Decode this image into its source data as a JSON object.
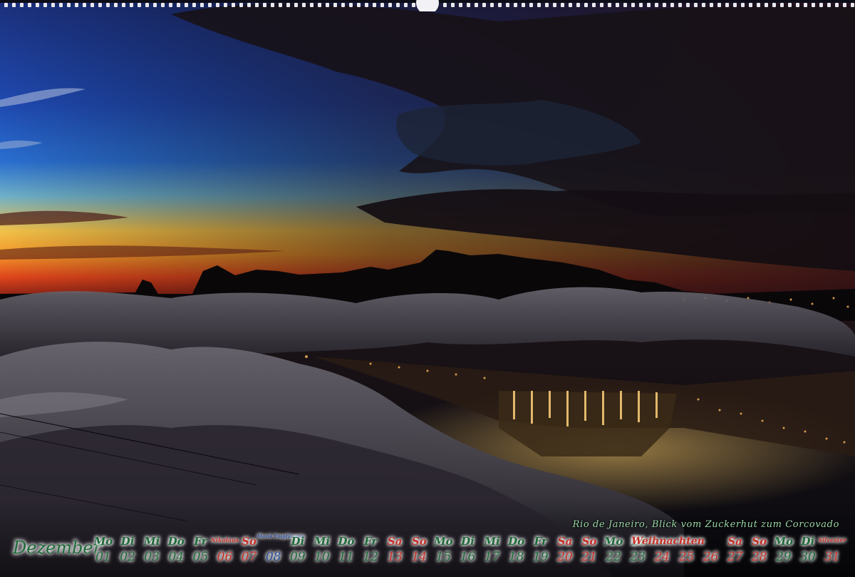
{
  "calendar": {
    "month": "Dezember",
    "caption": "Rio de Janeiro, Blick vom Zuckerhut zum Corcovado",
    "days": [
      {
        "name": "Mo",
        "num": "01",
        "kind": "workday"
      },
      {
        "name": "Di",
        "num": "02",
        "kind": "workday"
      },
      {
        "name": "Mi",
        "num": "03",
        "kind": "workday"
      },
      {
        "name": "Do",
        "num": "04",
        "kind": "workday"
      },
      {
        "name": "Fr",
        "num": "05",
        "kind": "workday"
      },
      {
        "name": "Nikolaus",
        "num": "06",
        "kind": "weekend",
        "style": "small"
      },
      {
        "name": "So",
        "num": "07",
        "kind": "weekend"
      },
      {
        "name": "Mariä Empfängnis",
        "num": "08",
        "kind": "feast",
        "style": "tiny"
      },
      {
        "name": "Di",
        "num": "09",
        "kind": "workday"
      },
      {
        "name": "Mi",
        "num": "10",
        "kind": "workday"
      },
      {
        "name": "Do",
        "num": "11",
        "kind": "workday"
      },
      {
        "name": "Fr",
        "num": "12",
        "kind": "workday"
      },
      {
        "name": "Sa",
        "num": "13",
        "kind": "weekend"
      },
      {
        "name": "So",
        "num": "14",
        "kind": "weekend"
      },
      {
        "name": "Mo",
        "num": "15",
        "kind": "workday"
      },
      {
        "name": "Di",
        "num": "16",
        "kind": "workday"
      },
      {
        "name": "Mi",
        "num": "17",
        "kind": "workday"
      },
      {
        "name": "Do",
        "num": "18",
        "kind": "workday"
      },
      {
        "name": "Fr",
        "num": "19",
        "kind": "workday"
      },
      {
        "name": "Sa",
        "num": "20",
        "kind": "weekend"
      },
      {
        "name": "So",
        "num": "21",
        "kind": "weekend"
      },
      {
        "name": "Mo",
        "num": "22",
        "kind": "workday"
      },
      {
        "name": "Di",
        "num": "23",
        "kind": "workday"
      },
      {
        "name": "Weihnachten",
        "num": "24",
        "kind": "weekend",
        "style": "wide"
      },
      {
        "name": "",
        "num": "25",
        "kind": "weekend"
      },
      {
        "name": "",
        "num": "26",
        "kind": "weekend"
      },
      {
        "name": "Sa",
        "num": "27",
        "kind": "weekend"
      },
      {
        "name": "So",
        "num": "28",
        "kind": "weekend"
      },
      {
        "name": "Mo",
        "num": "29",
        "kind": "workday"
      },
      {
        "name": "Di",
        "num": "30",
        "kind": "workday"
      },
      {
        "name": "Silvester",
        "num": "31",
        "kind": "weekend",
        "style": "small"
      }
    ]
  },
  "colors": {
    "workday": "#1f6b3a",
    "weekend": "#c8322a",
    "feast": "#2a4f9a",
    "caption": "#9bd8a8"
  }
}
